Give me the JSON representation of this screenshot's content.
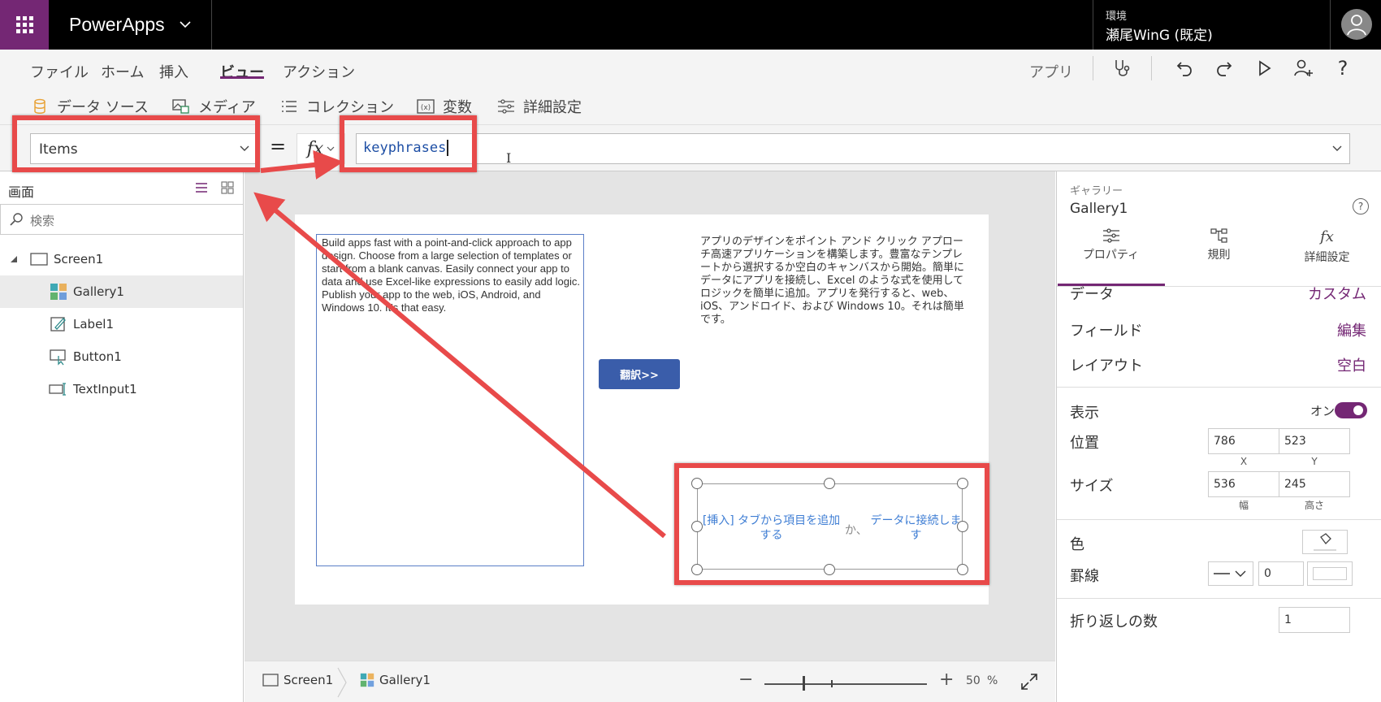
{
  "header": {
    "app_name": "PowerApps",
    "env_label": "環境",
    "env_name": "瀬尾WinG (既定)"
  },
  "menu": {
    "items": [
      "ファイル",
      "ホーム",
      "挿入",
      "ビュー",
      "アクション"
    ],
    "active": "ビュー",
    "app_label": "アプリ"
  },
  "ribbon": {
    "items": [
      "データ ソース",
      "メディア",
      "コレクション",
      "変数",
      "詳細設定"
    ]
  },
  "formula_bar": {
    "property": "Items",
    "equals": "=",
    "fx": "fx",
    "formula": "keyphrases"
  },
  "tree": {
    "title": "画面",
    "search_placeholder": "検索",
    "items": [
      {
        "label": "Screen1"
      },
      {
        "label": "Gallery1"
      },
      {
        "label": "Label1"
      },
      {
        "label": "Button1"
      },
      {
        "label": "TextInput1"
      }
    ]
  },
  "canvas": {
    "english_text": "Build apps fast with a point-and-click approach to app design. Choose from a large selection of templates or start from a blank canvas. Easily connect your app to data and use Excel-like expressions to easily add logic. Publish your app to the web, iOS, Android, and Windows 10. It's that easy.",
    "japanese_text": "アプリのデザインをポイント アンド クリック アプローチ高速アプリケーションを構築します。豊富なテンプレートから選択するか空白のキャンバスから開始。簡単にデータにアプリを接続し、Excel のような式を使用してロジックを簡単に追加。アプリを発行すると、web、iOS、アンドロイド、および Windows 10。それは簡単です。",
    "translate_button": "翻訳>>",
    "empty_gallery": {
      "insert_text": "[挿入] タブから項目を追加する",
      "or_text": "か、",
      "connect_text": "データに接続します"
    }
  },
  "status_bar": {
    "crumb_screen": "Screen1",
    "crumb_gallery": "Gallery1",
    "zoom_minus": "−",
    "zoom_plus": "+",
    "zoom_level": "50",
    "zoom_unit": "%"
  },
  "right_panel": {
    "type": "ギャラリー",
    "name": "Gallery1",
    "help": "?",
    "tabs": [
      "プロパティ",
      "規則",
      "詳細設定"
    ],
    "data_label": "データ",
    "data_value": "カスタム",
    "fields_label": "フィールド",
    "fields_value": "編集",
    "layout_label": "レイアウト",
    "layout_value": "空白",
    "visible_label": "表示",
    "visible_value": "オン",
    "position_label": "位置",
    "x": "786",
    "y": "523",
    "x_caption": "X",
    "y_caption": "Y",
    "size_label": "サイズ",
    "width": "536",
    "height": "245",
    "width_caption": "幅",
    "height_caption": "高さ",
    "color_label": "色",
    "border_label": "罫線",
    "border_width": "0",
    "wrap_label": "折り返しの数",
    "wrap_value": "1"
  },
  "colors": {
    "brand": "#742774",
    "annotation": "#e84a4a",
    "link": "#3f7ed4",
    "button": "#3a5daa"
  }
}
